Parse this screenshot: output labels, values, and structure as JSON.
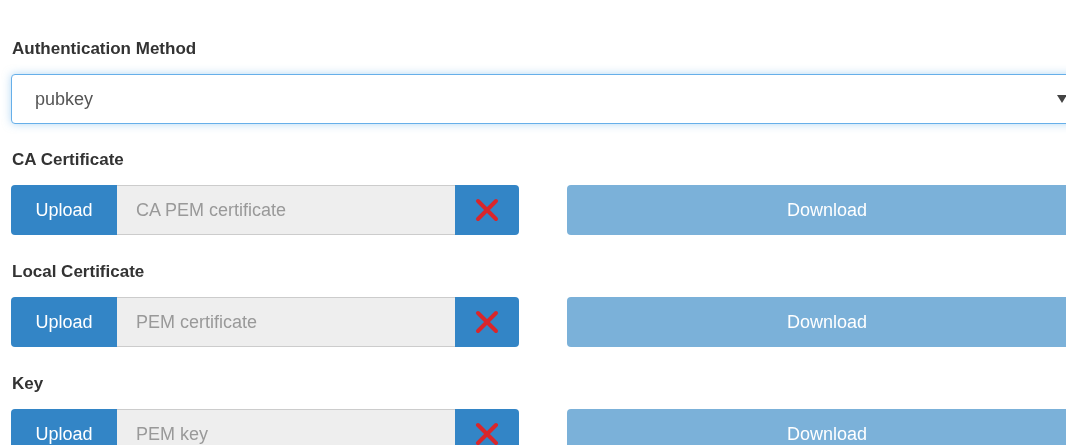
{
  "auth_method": {
    "label": "Authentication Method",
    "value": "pubkey",
    "focused": true
  },
  "file_fields": [
    {
      "label": "CA Certificate",
      "upload": "Upload",
      "placeholder": "CA PEM certificate",
      "download": "Download",
      "download_disabled": true
    },
    {
      "label": "Local Certificate",
      "upload": "Upload",
      "placeholder": "PEM certificate",
      "download": "Download",
      "download_disabled": true
    },
    {
      "label": "Key",
      "upload": "Upload",
      "placeholder": "PEM key",
      "download": "Download",
      "download_disabled": true
    }
  ]
}
